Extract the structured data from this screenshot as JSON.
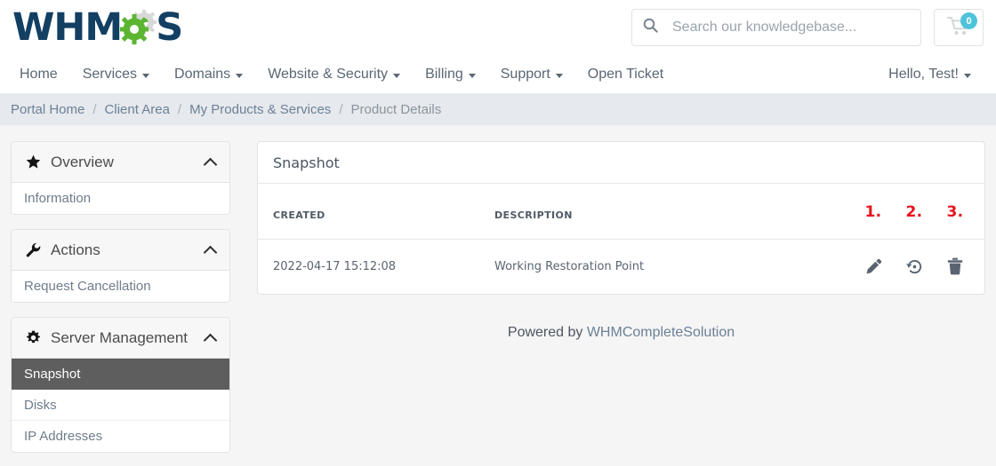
{
  "brand": {
    "logo_text_left": "WHM",
    "logo_text_right": "S",
    "navy": "#133f63",
    "gear_green": "#5cb531",
    "gear_gray": "#d8d8d8"
  },
  "search": {
    "placeholder": "Search our knowledgebase...",
    "value": "",
    "icon": "search-icon"
  },
  "cart": {
    "icon": "shopping-cart-icon",
    "count": "0",
    "badge_color": "#4ec3d9"
  },
  "nav": {
    "items": [
      {
        "label": "Home",
        "has_caret": false
      },
      {
        "label": "Services",
        "has_caret": true
      },
      {
        "label": "Domains",
        "has_caret": true
      },
      {
        "label": "Website & Security",
        "has_caret": true
      },
      {
        "label": "Billing",
        "has_caret": true
      },
      {
        "label": "Support",
        "has_caret": true
      },
      {
        "label": "Open Ticket",
        "has_caret": false
      }
    ],
    "account": {
      "label": "Hello, Test!",
      "has_caret": true
    }
  },
  "breadcrumb": {
    "separator": "/",
    "items": [
      {
        "label": "Portal Home",
        "active": false
      },
      {
        "label": "Client Area",
        "active": false
      },
      {
        "label": "My Products & Services",
        "active": false
      },
      {
        "label": "Product Details",
        "active": true
      }
    ]
  },
  "sidebar": {
    "panels": [
      {
        "title": "Overview",
        "icon": "star-icon",
        "collapse_icon": "chevron-up-icon",
        "items": [
          {
            "label": "Information",
            "active": false
          }
        ]
      },
      {
        "title": "Actions",
        "icon": "wrench-icon",
        "collapse_icon": "chevron-up-icon",
        "items": [
          {
            "label": "Request Cancellation",
            "active": false
          }
        ]
      },
      {
        "title": "Server Management",
        "icon": "gear-icon",
        "collapse_icon": "chevron-up-icon",
        "items": [
          {
            "label": "Snapshot",
            "active": true
          },
          {
            "label": "Disks",
            "active": false
          },
          {
            "label": "IP Addresses",
            "active": false
          }
        ]
      }
    ]
  },
  "main": {
    "card_title": "Snapshot",
    "table": {
      "columns": [
        "CREATED",
        "DESCRIPTION"
      ],
      "annotations": [
        "1.",
        "2.",
        "3."
      ],
      "annotation_color": "#e8131d",
      "rows": [
        {
          "created": "2022-04-17 15:12:08",
          "description": "Working Restoration Point",
          "actions": [
            {
              "name": "edit-icon",
              "title": "Edit"
            },
            {
              "name": "restore-icon",
              "title": "Restore"
            },
            {
              "name": "delete-icon",
              "title": "Delete"
            }
          ]
        }
      ]
    }
  },
  "footer": {
    "prefix": "Powered by ",
    "link_label": "WHMCompleteSolution"
  }
}
